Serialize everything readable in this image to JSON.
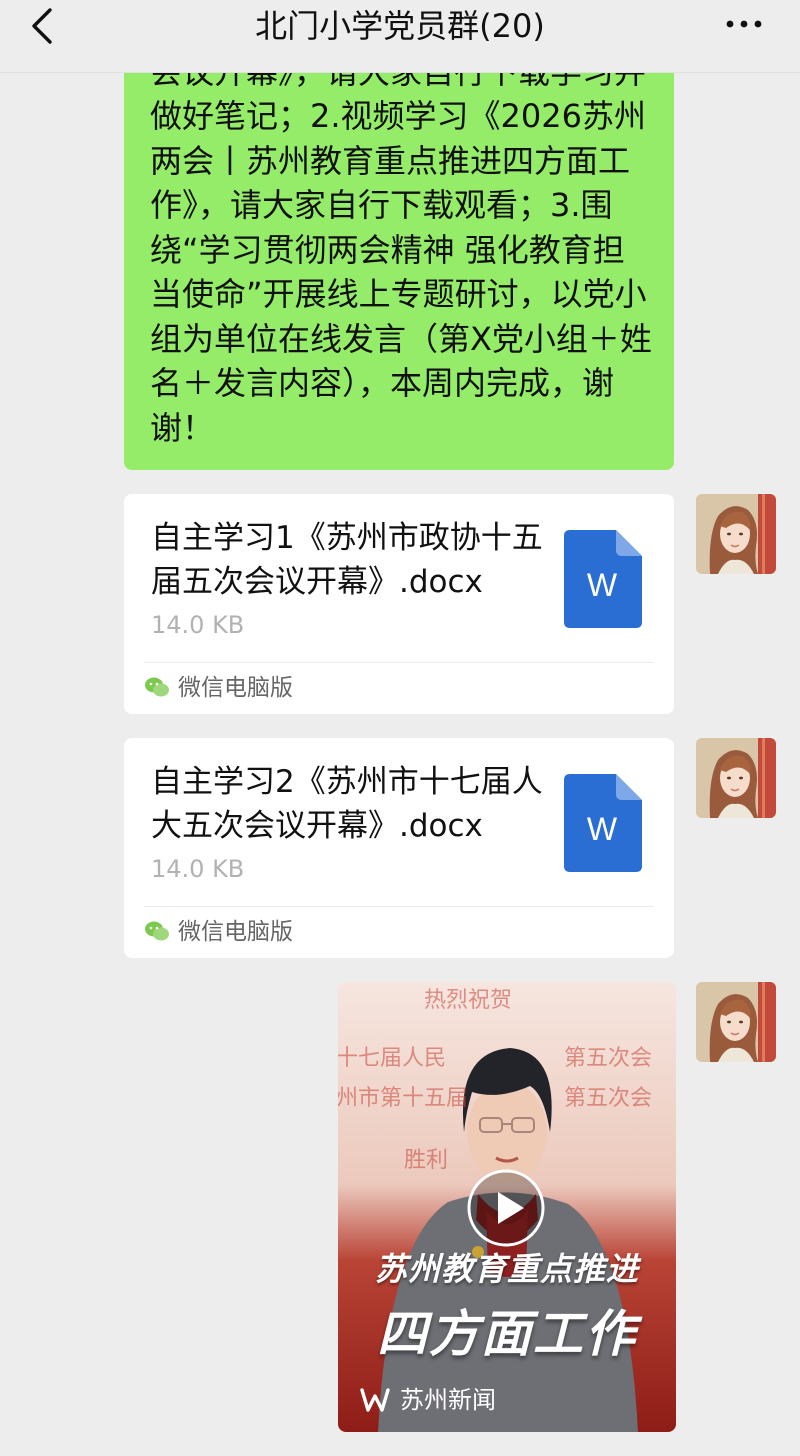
{
  "navbar": {
    "title": "北门小学党员群(20)"
  },
  "messages": {
    "text_message": "会议开幕》，请大家自行下载学习并做好笔记；2.视频学习《2026苏州两会丨苏州教育重点推进四方面工作》，请大家自行下载观看；3.围绕“学习贯彻两会精神 强化教育担当使命”开展线上专题研讨，以党小组为单位在线发言（第X党小组＋姓名＋发言内容），本周内完成，谢谢！",
    "files": [
      {
        "name": "自主学习1《苏州市政协十五届五次会议开幕》.docx",
        "size": "14.0 KB",
        "source": "微信电脑版",
        "icon_letter": "W"
      },
      {
        "name": "自主学习2《苏州市十七届人大五次会议开幕》.docx",
        "size": "14.0 KB",
        "source": "微信电脑版",
        "icon_letter": "W"
      }
    ],
    "video": {
      "headline": "苏州教育重点推进",
      "headline_2": "四方面工作",
      "source": "苏州新闻",
      "background_text": [
        "热烈祝贺",
        "十七届人民",
        "第五次会",
        "州市第十五届",
        "第五次会",
        "胜利"
      ]
    }
  },
  "colors": {
    "own_bubble": "#95ec69",
    "chat_bg": "#ededed",
    "word_icon": "#2a6ed3",
    "video_red": "#b5302a"
  },
  "icons": {
    "back": "chevron-left-icon",
    "more": "ellipsis-icon",
    "file": "word-document-icon",
    "source": "wechat-icon",
    "video_play": "play-icon",
    "video_source": "suzhou-news-icon"
  }
}
